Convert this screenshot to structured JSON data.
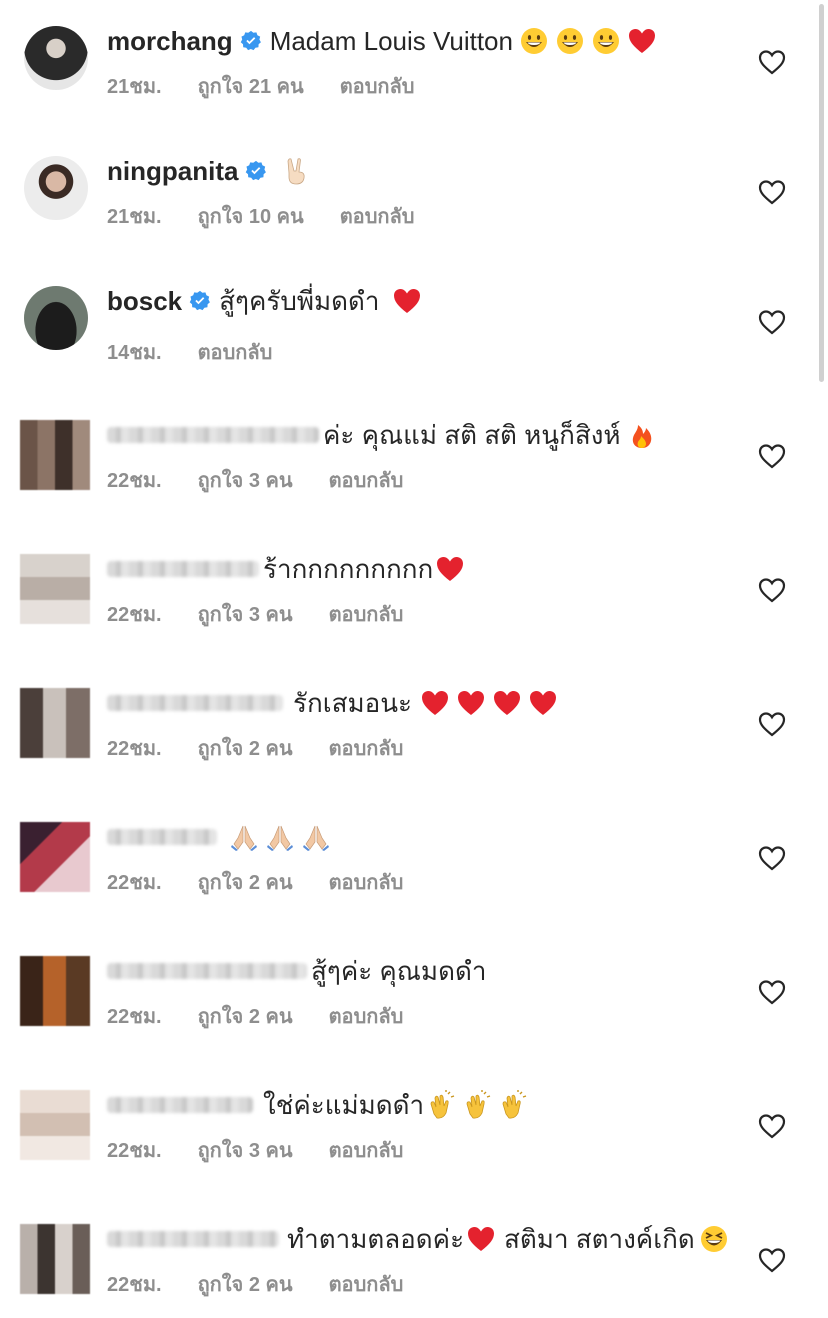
{
  "comments": [
    {
      "username": "morchang",
      "verified": true,
      "text": "Madam Louis Vuitton",
      "emojis": [
        "grin",
        "grin",
        "grin",
        "heart"
      ],
      "time": "21ชม.",
      "likes": "ถูกใจ 21 คน",
      "reply": "ตอบกลับ",
      "avatar": "photo-man-suit"
    },
    {
      "username": "ningpanita",
      "verified": true,
      "text": "",
      "emojis": [
        "peace"
      ],
      "time": "21ชม.",
      "likes": "ถูกใจ 10 คน",
      "reply": "ตอบกลับ",
      "avatar": "photo-woman"
    },
    {
      "username": "bosck",
      "verified": true,
      "text": "สู้ๆครับพี่มดดำ",
      "emojis": [
        "heart"
      ],
      "time": "14ชม.",
      "likes": "",
      "reply": "ตอบกลับ",
      "avatar": "photo-black-cloak"
    },
    {
      "username": "",
      "verified": false,
      "text": "ค่ะ คุณแม่ สติ สติ หนูก็สิงห์",
      "emojis": [
        "fire"
      ],
      "time": "22ชม.",
      "likes": "ถูกใจ 3 คน",
      "reply": "ตอบกลับ",
      "avatar": "pixelated"
    },
    {
      "username": "",
      "verified": false,
      "text": "ร้ากกกกกกกกก",
      "emojis": [
        "heart"
      ],
      "time": "22ชม.",
      "likes": "ถูกใจ 3 คน",
      "reply": "ตอบกลับ",
      "avatar": "pixelated"
    },
    {
      "username": "",
      "verified": false,
      "text": "รักเสมอนะ",
      "emojis": [
        "heart",
        "heart",
        "heart",
        "heart"
      ],
      "time": "22ชม.",
      "likes": "ถูกใจ 2 คน",
      "reply": "ตอบกลับ",
      "avatar": "pixelated"
    },
    {
      "username": "",
      "verified": false,
      "text": "",
      "emojis": [
        "pray",
        "pray",
        "pray"
      ],
      "time": "22ชม.",
      "likes": "ถูกใจ 2 คน",
      "reply": "ตอบกลับ",
      "avatar": "pixelated"
    },
    {
      "username": "",
      "verified": false,
      "text": "สู้ๆค่ะ คุณมดดำ",
      "emojis": [],
      "time": "22ชม.",
      "likes": "ถูกใจ 2 คน",
      "reply": "ตอบกลับ",
      "avatar": "pixelated"
    },
    {
      "username": "",
      "verified": false,
      "text": "ใช่ค่ะแม่มดดำ",
      "emojis": [
        "clap",
        "clap",
        "clap"
      ],
      "time": "22ชม.",
      "likes": "ถูกใจ 3 คน",
      "reply": "ตอบกลับ",
      "avatar": "pixelated"
    },
    {
      "username": "",
      "verified": false,
      "text": "ทำตามตลอดค่ะ",
      "emojis": [
        "heart"
      ],
      "text2": "สติมา สตางค์เกิด",
      "emojis2": [
        "laugh"
      ],
      "time": "22ชม.",
      "likes": "ถูกใจ 2 คน",
      "reply": "ตอบกลับ",
      "avatar": "pixelated"
    }
  ],
  "colors": {
    "text": "#262626",
    "meta": "#8e8e8e",
    "verified": "#3897f0",
    "heart_red": "#ed2a3d"
  }
}
